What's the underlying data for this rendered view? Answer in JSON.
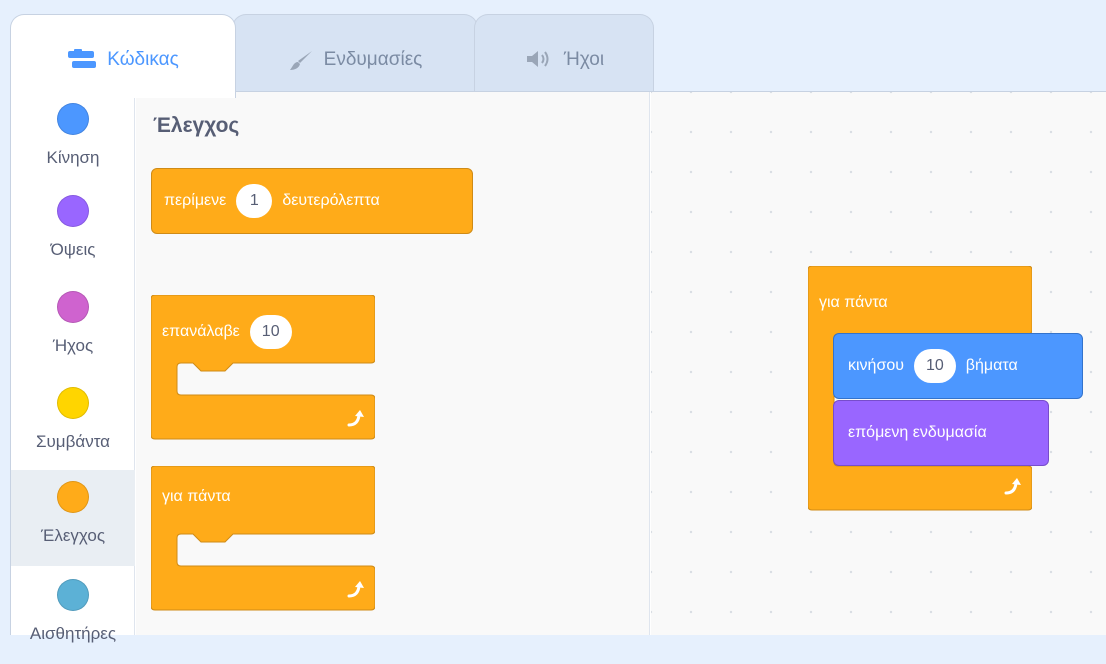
{
  "tabs": [
    {
      "label": "Κώδικας",
      "icon": "code-icon",
      "active": true
    },
    {
      "label": "Ενδυμασίες",
      "icon": "brush-icon",
      "active": false
    },
    {
      "label": "Ήχοι",
      "icon": "speaker-icon",
      "active": false
    }
  ],
  "categories": [
    {
      "label": "Κίνηση",
      "color": "#4c97ff"
    },
    {
      "label": "Όψεις",
      "color": "#9966ff"
    },
    {
      "label": "Ήχος",
      "color": "#cf63cf"
    },
    {
      "label": "Συμβάντα",
      "color": "#ffd500"
    },
    {
      "label": "Έλεγχος",
      "color": "#ffab19",
      "selected": true
    },
    {
      "label": "Αισθητήρες",
      "color": "#5cb1d6"
    }
  ],
  "palette": {
    "title": "Έλεγχος",
    "wait_block": {
      "prefix": "περίμενε",
      "value": "1",
      "suffix": "δευτερόλεπτα"
    },
    "repeat_block": {
      "label": "επανάλαβε",
      "value": "10"
    },
    "forever_block": {
      "label": "για πάντα"
    }
  },
  "script": {
    "forever_label": "για πάντα",
    "move_block": {
      "prefix": "κινήσου",
      "value": "10",
      "suffix": "βήματα"
    },
    "next_costume_label": "επόμενη ενδυμασία"
  },
  "colors": {
    "control": "#ffab19",
    "motion": "#4c97ff",
    "looks": "#9966ff",
    "accent": "#4c97ff"
  }
}
